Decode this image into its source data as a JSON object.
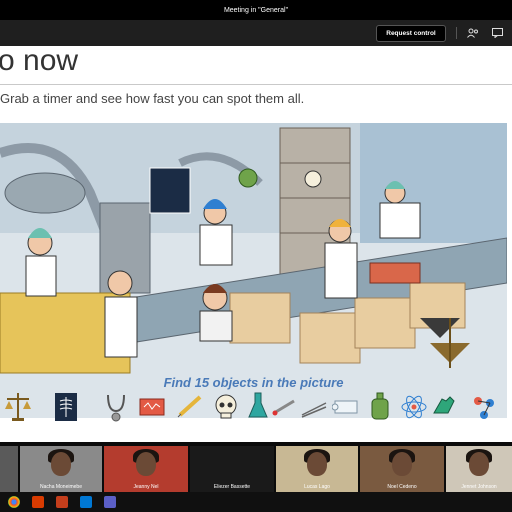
{
  "window": {
    "title": "Meeting in \"General\""
  },
  "toolbar": {
    "request_control": "Request control",
    "participants_icon": "people-icon",
    "chat_icon": "chat-icon"
  },
  "slide": {
    "title": "o now",
    "subtitle": "Grab a timer and see how fast you can spot them all.",
    "caption": "Find 15 objects in the picture",
    "objects": [
      "scales",
      "x-ray",
      "stethoscope",
      "hot-water-bottle",
      "syringe",
      "skull",
      "flask",
      "thermometer",
      "tweezers",
      "scroll",
      "hot-water-bottle",
      "atom",
      "glove",
      "molecule",
      "syringe"
    ]
  },
  "participants": [
    {
      "name": ""
    },
    {
      "name": "Nacha Moneimebe"
    },
    {
      "name": "Jeanny Nel"
    },
    {
      "name": "Eliezer Bassette"
    },
    {
      "name": "Lucas Lago"
    },
    {
      "name": "Noel Cedeno"
    },
    {
      "name": "Jennet Johnson"
    }
  ],
  "taskbar": {
    "apps": [
      "chrome-icon",
      "office-icon",
      "powerpoint-icon",
      "store-icon",
      "teams-icon"
    ]
  }
}
